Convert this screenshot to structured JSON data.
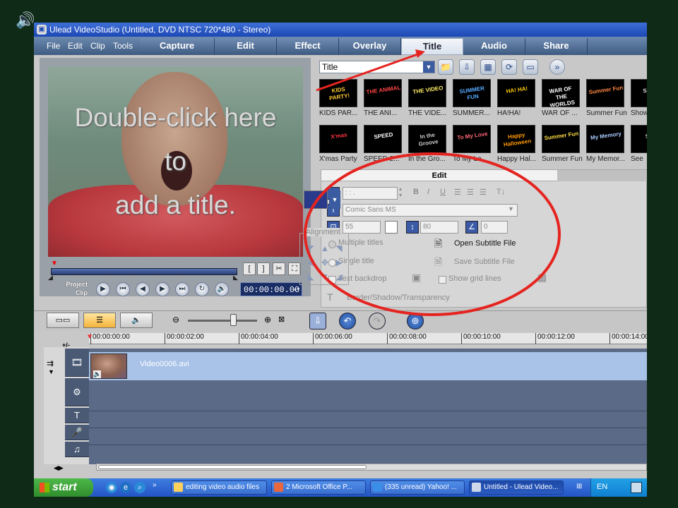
{
  "window": {
    "title": "Ulead VideoStudio (Untitled, DVD NTSC 720*480 - Stereo)"
  },
  "menu": {
    "file": "File",
    "edit": "Edit",
    "clip": "Clip",
    "tools": "Tools"
  },
  "steps": [
    {
      "label": "Capture"
    },
    {
      "label": "Edit"
    },
    {
      "label": "Effect"
    },
    {
      "label": "Overlay"
    },
    {
      "label": "Title"
    },
    {
      "label": "Audio"
    },
    {
      "label": "Share"
    }
  ],
  "active_step": "Title",
  "preview": {
    "overlay_text": "Double-click here\nto\nadd a title.",
    "project_label": "Project",
    "clip_label": "Clip",
    "timecode": "00:00:00.00"
  },
  "library": {
    "category": "Title",
    "thumbnails": [
      {
        "caption": "KIDS PAR...",
        "art": "KIDS PARTY!",
        "color": "#ffcc33"
      },
      {
        "caption": "THE ANI...",
        "art": "THE ANIMAL",
        "color": "#ff4444"
      },
      {
        "caption": "THE VIDE...",
        "art": "THE VIDEO",
        "color": "#ffee66"
      },
      {
        "caption": "SUMMER...",
        "art": "SUMMER FUN",
        "color": "#55aaff"
      },
      {
        "caption": "HA!HA!",
        "art": "HA! HA!",
        "color": "#ffcc00"
      },
      {
        "caption": "WAR OF ...",
        "art": "WAR OF THE WORLDS",
        "color": "#ffffff"
      },
      {
        "caption": "Summer Fun",
        "art": "Summer Fun",
        "color": "#ff8844"
      },
      {
        "caption": "Show",
        "art": "Show",
        "color": "#dddddd"
      },
      {
        "caption": "X'mas Party",
        "art": "X'mas",
        "color": "#ff3344"
      },
      {
        "caption": "SPEED 2...",
        "art": "SPEED",
        "color": "#ffffff"
      },
      {
        "caption": "In the Gro...",
        "art": "In the Groove",
        "color": "#cccccc"
      },
      {
        "caption": "To My Lo...",
        "art": "To My Love",
        "color": "#ff6677"
      },
      {
        "caption": "Happy Hal...",
        "art": "Happy Halloween",
        "color": "#ff9900"
      },
      {
        "caption": "Summer Fun",
        "art": "Summer Fun",
        "color": "#ffdd44"
      },
      {
        "caption": "My Memor...",
        "art": "My Memory",
        "color": "#aaccff"
      },
      {
        "caption": "See",
        "art": "See",
        "color": "#dddddd"
      }
    ]
  },
  "edit_panel": {
    "tab_label": "Edit",
    "duration": "  :  :  .",
    "font_name": "Comic Sans MS",
    "font_size": "55",
    "line_spacing": "80",
    "angle": "0",
    "multiple_titles": "Multiple titles",
    "single_title": "Single title",
    "text_backdrop": "Text backdrop",
    "open_subtitle": "Open Subtitle File",
    "save_subtitle": "Save Subtitle File",
    "show_grid": "Show grid lines",
    "border_shadow": "Border/Shadow/Transparency",
    "alignment_label": "Alignment"
  },
  "timeline": {
    "ruler": [
      "00:00:00:00",
      "00:00:02:00",
      "00:00:04:00",
      "00:00:06:00",
      "00:00:08:00",
      "00:00:10:00",
      "00:00:12:00",
      "00:00:14:00"
    ],
    "clip_name": "Video0006.avi",
    "zoom_label": "+/-"
  },
  "taskbar": {
    "start": "start",
    "tasks": [
      {
        "label": "editing video audio files"
      },
      {
        "label": "2 Microsoft Office P..."
      },
      {
        "label": "(335 unread) Yahoo! ..."
      },
      {
        "label": "Untitled - Ulead Video..."
      }
    ],
    "lang": "EN"
  },
  "colors": {
    "annotation": "#e52420",
    "accent_title_bar": "#1c48b4",
    "selected_color": "#2a3a8a"
  }
}
